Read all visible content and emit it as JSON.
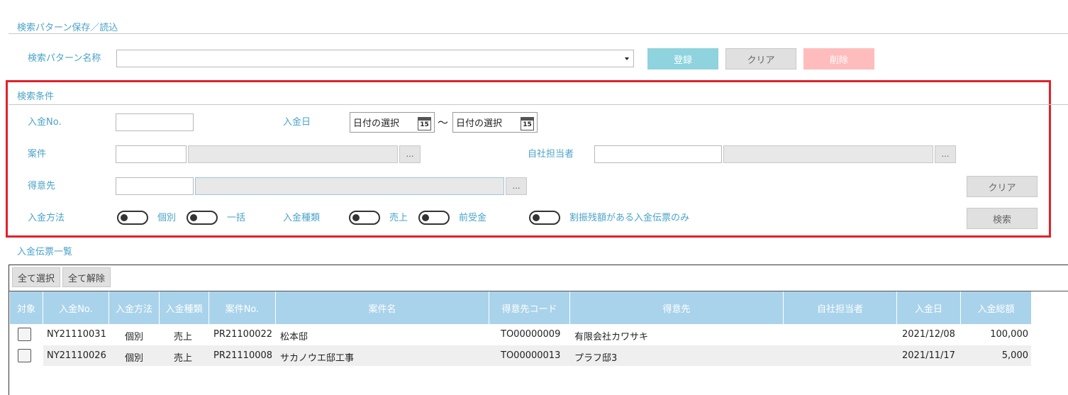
{
  "pattern_section": {
    "title": "検索パターン保存／読込",
    "name_label": "検索パターン名称",
    "register_label": "登録",
    "clear_label": "クリア",
    "delete_label": "削除"
  },
  "search_section": {
    "title": "検索条件",
    "payment_no_label": "入金No.",
    "payment_date_label": "入金日",
    "date_from_placeholder": "日付の選択",
    "date_to_placeholder": "日付の選択",
    "date_range_sep": "～",
    "calendar_day": "15",
    "project_label": "案件",
    "own_staff_label": "自社担当者",
    "customer_label": "得意先",
    "method_label": "入金方法",
    "method_individual": "個別",
    "method_bulk": "一括",
    "type_label": "入金種類",
    "type_sales": "売上",
    "type_advance": "前受金",
    "remaining_only_label": "割振残額がある入金伝票のみ",
    "clear_label": "クリア",
    "search_label": "検索",
    "lookup_label": "…"
  },
  "list_section": {
    "title": "入金伝票一覧",
    "select_all_label": "全て選択",
    "deselect_all_label": "全て解除",
    "columns": [
      "対象",
      "入金No.",
      "入金方法",
      "入金種類",
      "案件No.",
      "案件名",
      "得意先コード",
      "得意先",
      "自社担当者",
      "入金日",
      "入金総額"
    ],
    "rows": [
      {
        "no": "NY21110031",
        "method": "個別",
        "type": "売上",
        "project_no": "PR21100022",
        "project_name": "松本邸",
        "customer_code": "TO00000009",
        "customer": "有限会社カワサキ",
        "staff": "",
        "date": "2021/12/08",
        "amount": "100,000"
      },
      {
        "no": "NY21110026",
        "method": "個別",
        "type": "売上",
        "project_no": "PR21110008",
        "project_name": "サカノウエ邸工事",
        "customer_code": "TO00000013",
        "customer": "プラフ邸3",
        "staff": "",
        "date": "2021/11/17",
        "amount": "5,000"
      }
    ]
  },
  "colors": {
    "label": "#4aa3c8",
    "highlight": "#e0222a",
    "table_header": "#a9d3ea",
    "register_button": "#8ed3de",
    "delete_button": "#ffbcbc"
  }
}
